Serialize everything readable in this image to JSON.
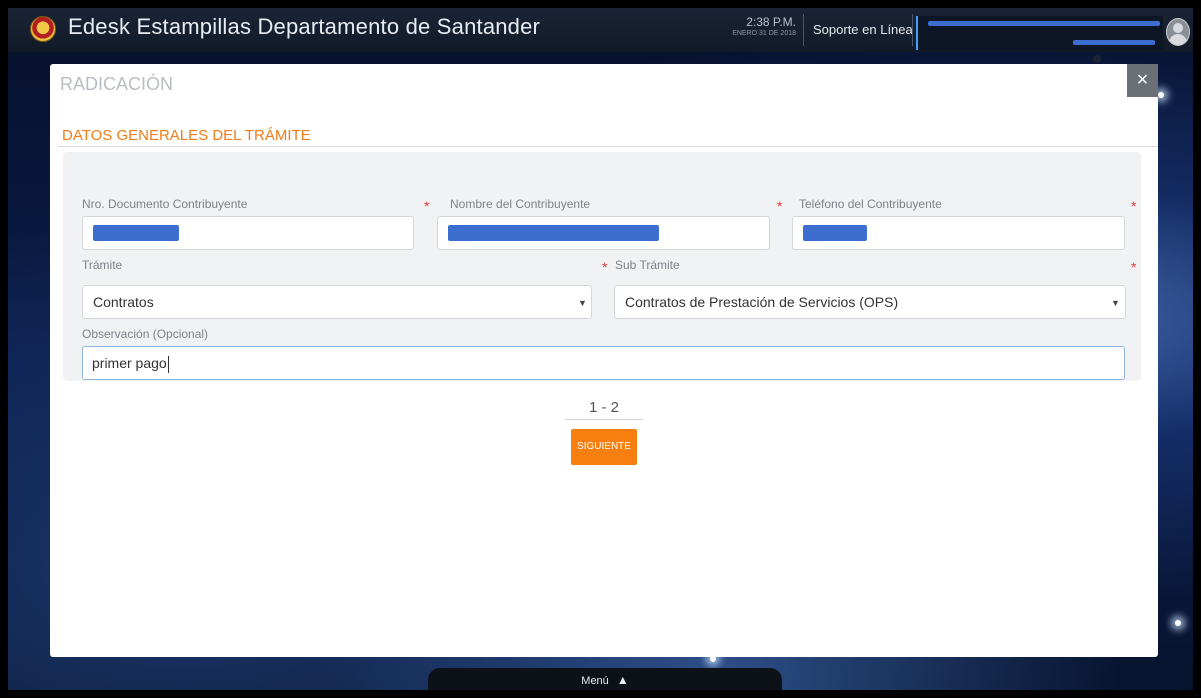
{
  "app": {
    "title": "Edesk Estampillas Departamento de Santander"
  },
  "header": {
    "time": "2:38 P.M.",
    "date": "ENERO 31 DE 2018",
    "support_label": "Soporte en Línea",
    "logo_icon": "coat-of-arms-logo",
    "avatar_icon": "user-avatar-icon"
  },
  "modal": {
    "title": "RADICACIÓN",
    "close_label": "×",
    "section_title": "DATOS GENERALES DEL TRÁMITE"
  },
  "form": {
    "doc_label": "Nro. Documento Contribuyente",
    "name_label": "Nombre del Contribuyente",
    "phone_label": "Teléfono del Contribuyente",
    "tramite_label": "Trámite",
    "tramite_value": "Contratos",
    "subtramite_label": "Sub Trámite",
    "subtramite_value": "Contratos de Prestación de Servicios (OPS)",
    "obs_label": "Observación (Opcional)",
    "obs_value": "primer pago",
    "required_mark": "*"
  },
  "pager": {
    "text": "1  -  2"
  },
  "actions": {
    "next_label": "SIGUIENTE"
  },
  "footer": {
    "menu_label": "Menú",
    "menu_icon": "triangle-up-icon"
  },
  "colors": {
    "accent_orange": "#f77f0f",
    "section_title": "#f07c1a",
    "required": "#e53b3b",
    "redaction": "#3d6ecf",
    "topbar": "#1a2436"
  }
}
